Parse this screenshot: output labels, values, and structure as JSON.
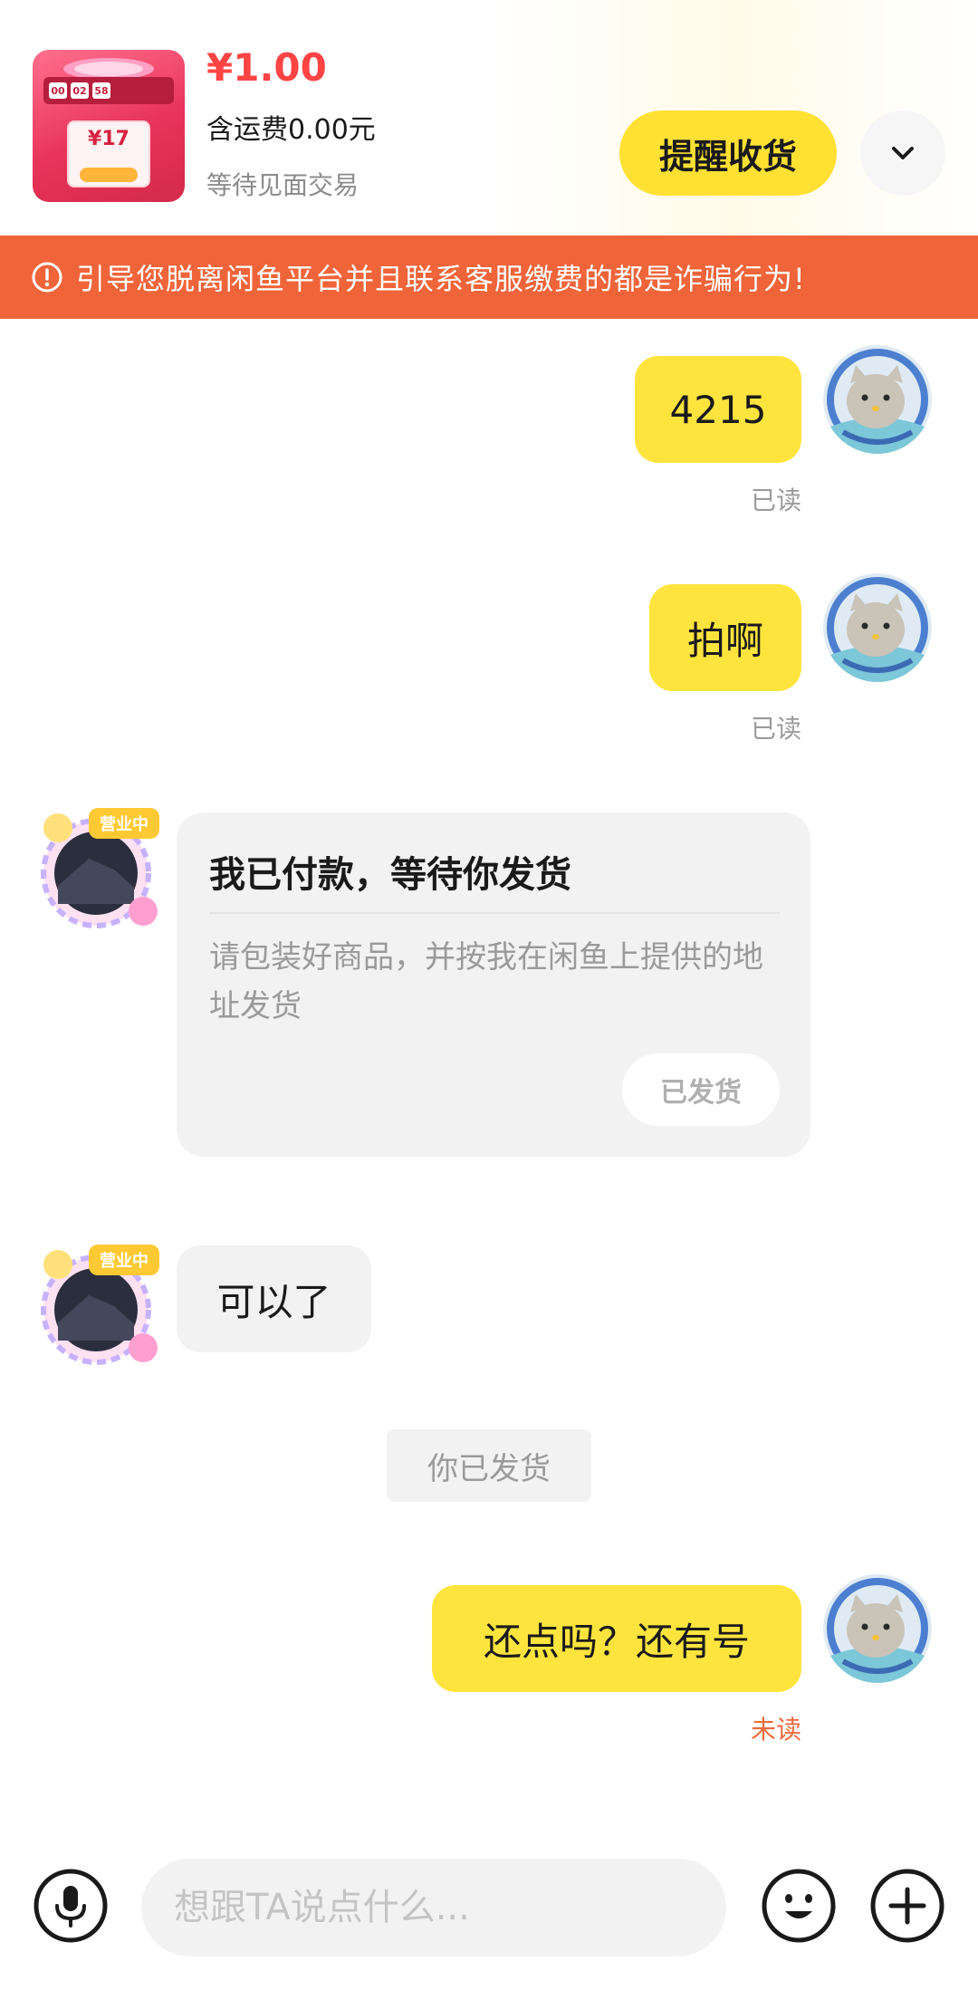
{
  "header": {
    "product_thumb": {
      "timer": [
        "00",
        "02",
        "58"
      ],
      "coupon_price": "¥17"
    },
    "price": "¥1.00",
    "shipping": "含运费0.00元",
    "status": "等待见面交易",
    "remind_button": "提醒收货",
    "expand_icon": "chevron-down-icon"
  },
  "warning": {
    "icon": "alert-circle-icon",
    "text": "引导您脱离闲鱼平台并且联系客服缴费的都是诈骗行为!"
  },
  "messages": [
    {
      "from": "me",
      "text": "4215",
      "status": "已读"
    },
    {
      "from": "me",
      "text": "拍啊",
      "status": "已读"
    },
    {
      "from": "other",
      "type": "card",
      "title": "我已付款，等待你发货",
      "body": "请包装好商品，并按我在闲鱼上提供的地址发货",
      "button": "已发货"
    },
    {
      "from": "other",
      "text": "可以了"
    },
    {
      "from": "system",
      "text": "你已发货"
    },
    {
      "from": "me",
      "text": "还点吗？还有号",
      "status": "未读"
    }
  ],
  "avatar_badge": "营业中",
  "input_bar": {
    "placeholder": "想跟TA说点什么...",
    "icons": [
      "microphone-icon",
      "emoji-icon",
      "plus-icon"
    ]
  },
  "colors": {
    "my_bubble": "#ffe43e",
    "other_bubble": "#f2f2f3",
    "warning_bg": "#f0643a",
    "price": "#ff4444",
    "unread": "#ee6a3c",
    "remind_button": "#ffe033"
  }
}
